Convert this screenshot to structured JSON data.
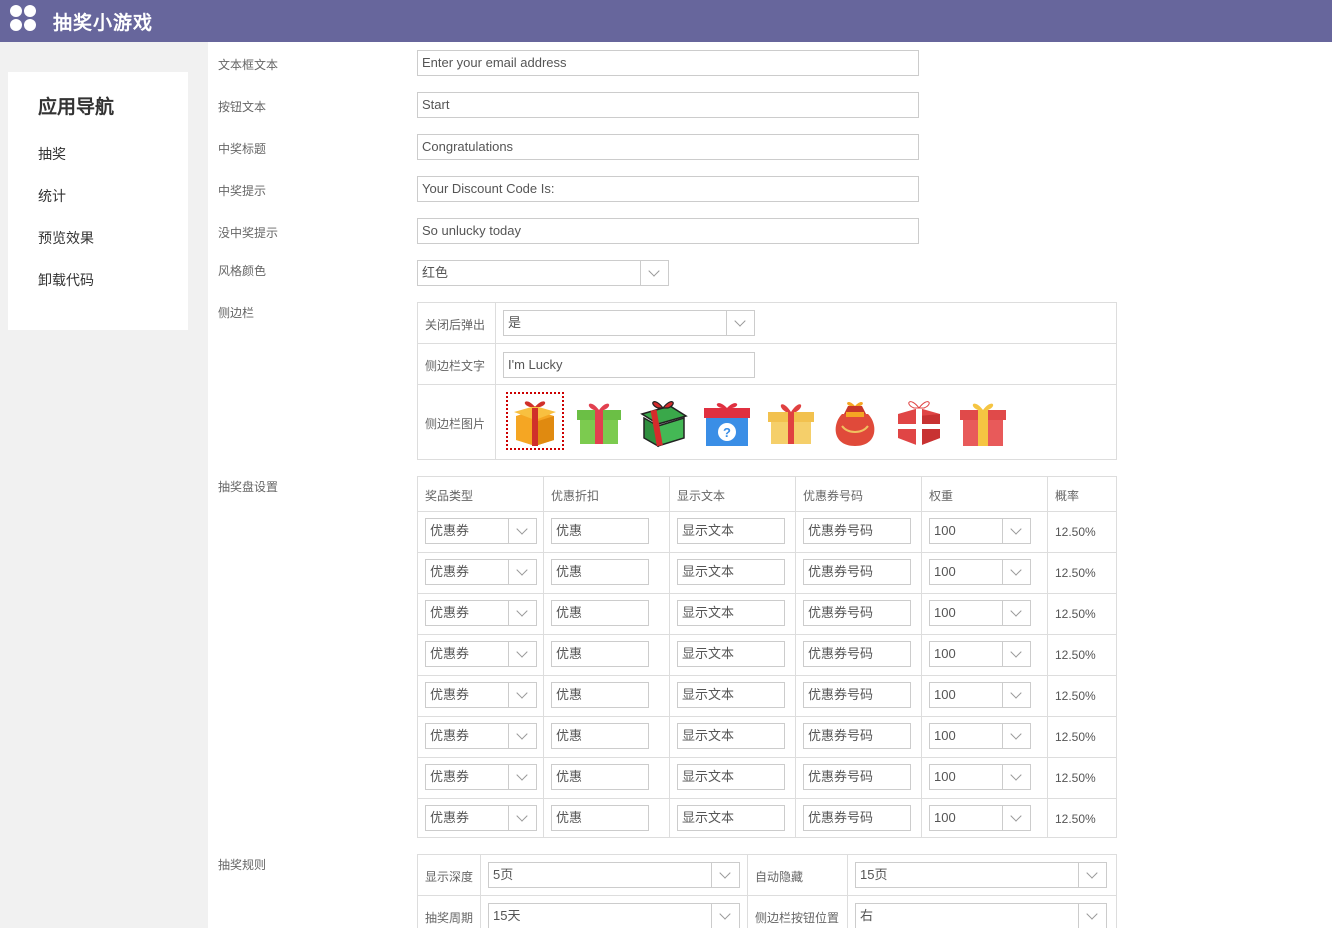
{
  "app": {
    "title": "抽奖小游戏"
  },
  "nav": {
    "title": "应用导航",
    "items": [
      {
        "label": "抽奖"
      },
      {
        "label": "统计"
      },
      {
        "label": "预览效果"
      },
      {
        "label": "卸载代码"
      }
    ]
  },
  "form": {
    "textbox": {
      "label": "文本框文本",
      "value": "Enter your email address"
    },
    "button": {
      "label": "按钮文本",
      "value": "Start"
    },
    "win_title": {
      "label": "中奖标题",
      "value": "Congratulations"
    },
    "win_tip": {
      "label": "中奖提示",
      "value": "Your Discount Code Is:"
    },
    "lose_tip": {
      "label": "没中奖提示",
      "value": "So unlucky today"
    },
    "style_color": {
      "label": "风格颜色",
      "value": "红色"
    },
    "sidebar": {
      "label": "侧边栏",
      "popup_label": "关闭后弹出",
      "popup_value": "是",
      "text_label": "侧边栏文字",
      "text_value": "I'm Lucky",
      "image_label": "侧边栏图片",
      "images": [
        "gift-box-orange-icon",
        "gift-box-green-icon",
        "gift-box-darkgreen-icon",
        "gift-box-blue-question-icon",
        "gift-box-yellow-icon",
        "gift-bag-red-icon",
        "gift-box-red-white-icon",
        "gift-box-red-yellow-icon"
      ],
      "selected_image": 0
    },
    "wheel": {
      "label": "抽奖盘设置",
      "headers": [
        "奖品类型",
        "优惠折扣",
        "显示文本",
        "优惠券号码",
        "权重",
        "概率"
      ],
      "rows": [
        {
          "type": "优惠券",
          "discount": "优惠",
          "text": "显示文本",
          "code": "优惠券号码",
          "weight": "100",
          "prob": "12.50%"
        },
        {
          "type": "优惠券",
          "discount": "优惠",
          "text": "显示文本",
          "code": "优惠券号码",
          "weight": "100",
          "prob": "12.50%"
        },
        {
          "type": "优惠券",
          "discount": "优惠",
          "text": "显示文本",
          "code": "优惠券号码",
          "weight": "100",
          "prob": "12.50%"
        },
        {
          "type": "优惠券",
          "discount": "优惠",
          "text": "显示文本",
          "code": "优惠券号码",
          "weight": "100",
          "prob": "12.50%"
        },
        {
          "type": "优惠券",
          "discount": "优惠",
          "text": "显示文本",
          "code": "优惠券号码",
          "weight": "100",
          "prob": "12.50%"
        },
        {
          "type": "优惠券",
          "discount": "优惠",
          "text": "显示文本",
          "code": "优惠券号码",
          "weight": "100",
          "prob": "12.50%"
        },
        {
          "type": "优惠券",
          "discount": "优惠",
          "text": "显示文本",
          "code": "优惠券号码",
          "weight": "100",
          "prob": "12.50%"
        },
        {
          "type": "优惠券",
          "discount": "优惠",
          "text": "显示文本",
          "code": "优惠券号码",
          "weight": "100",
          "prob": "12.50%"
        }
      ]
    },
    "rules": {
      "label": "抽奖规则",
      "depth_label": "显示深度",
      "depth_value": "5页",
      "autohide_label": "自动隐藏",
      "autohide_value": "15页",
      "period_label": "抽奖周期",
      "period_value": "15天",
      "btnpos_label": "侧边栏按钮位置",
      "btnpos_value": "右"
    }
  },
  "colors": {
    "topbar": "#67669c",
    "sidebar_bg": "#f1f1f1"
  }
}
